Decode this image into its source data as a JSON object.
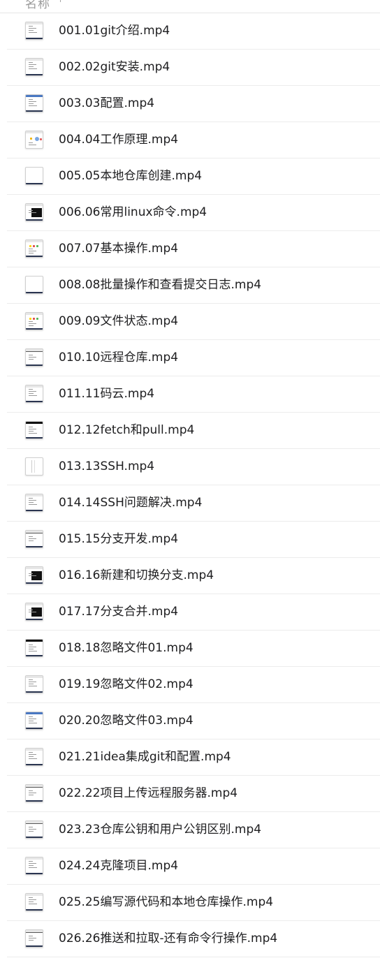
{
  "header": {
    "column_label": "名称",
    "sort_glyph": "↑"
  },
  "files": [
    {
      "name": "001.01git介绍.mp4",
      "thumb": "doc"
    },
    {
      "name": "002.02git安装.mp4",
      "thumb": "doc"
    },
    {
      "name": "003.03配置.mp4",
      "thumb": "blue-header"
    },
    {
      "name": "004.04工作原理.mp4",
      "thumb": "diagram"
    },
    {
      "name": "005.05本地仓库创建.mp4",
      "thumb": "blank"
    },
    {
      "name": "006.06常用linux命令.mp4",
      "thumb": "terminal"
    },
    {
      "name": "007.07基本操作.mp4",
      "thumb": "colored"
    },
    {
      "name": "008.08批量操作和查看提交日志.mp4",
      "thumb": "blank"
    },
    {
      "name": "009.09文件状态.mp4",
      "thumb": "colored"
    },
    {
      "name": "010.10远程仓库.mp4",
      "thumb": "window"
    },
    {
      "name": "011.11码云.mp4",
      "thumb": "doc"
    },
    {
      "name": "012.12fetch和pull.mp4",
      "thumb": "dark-header"
    },
    {
      "name": "013.13SSH.mp4",
      "thumb": "faint"
    },
    {
      "name": "014.14SSH问题解决.mp4",
      "thumb": "doc"
    },
    {
      "name": "015.15分支开发.mp4",
      "thumb": "window"
    },
    {
      "name": "016.16新建和切换分支.mp4",
      "thumb": "terminal"
    },
    {
      "name": "017.17分支合并.mp4",
      "thumb": "terminal"
    },
    {
      "name": "018.18忽略文件01.mp4",
      "thumb": "dark-header"
    },
    {
      "name": "019.19忽略文件02.mp4",
      "thumb": "doc"
    },
    {
      "name": "020.20忽略文件03.mp4",
      "thumb": "blue-header"
    },
    {
      "name": "021.21idea集成git和配置.mp4",
      "thumb": "doc"
    },
    {
      "name": "022.22项目上传远程服务器.mp4",
      "thumb": "window"
    },
    {
      "name": "023.23仓库公钥和用户公钥区别.mp4",
      "thumb": "window"
    },
    {
      "name": "024.24克隆项目.mp4",
      "thumb": "doc"
    },
    {
      "name": "025.25编写源代码和本地仓库操作.mp4",
      "thumb": "doc"
    },
    {
      "name": "026.26推送和拉取-还有命令行操作.mp4",
      "thumb": "window"
    }
  ]
}
